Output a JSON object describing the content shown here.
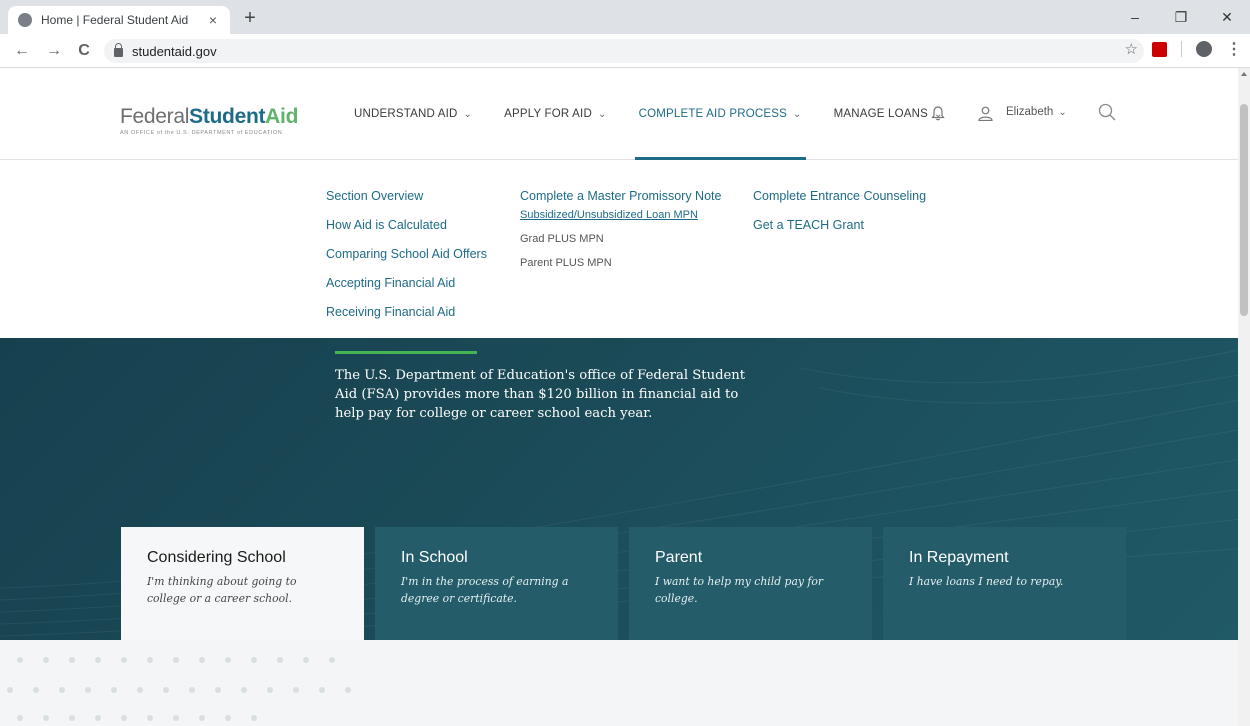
{
  "browser": {
    "tab_title": "Home | Federal Student Aid",
    "tab_close": "×",
    "new_tab": "+",
    "url": "studentaid.gov",
    "back": "←",
    "forward": "→",
    "reload": "C",
    "bookmark": "☆",
    "menu": "⋮",
    "minimize": "–",
    "maximize": "❐",
    "close": "✕"
  },
  "header": {
    "logo_text_federal": "Federal",
    "logo_text_student": "Student",
    "logo_text_aid": "Aid",
    "logo_subtitle": "AN OFFICE of the U.S. DEPARTMENT of EDUCATION",
    "nav": [
      {
        "label": "UNDERSTAND AID"
      },
      {
        "label": "APPLY FOR AID"
      },
      {
        "label": "COMPLETE AID PROCESS"
      },
      {
        "label": "MANAGE LOANS"
      }
    ],
    "user_name": "Elizabeth",
    "chevron": "⌄"
  },
  "mega_menu": {
    "col1": [
      "Section Overview",
      "How Aid is Calculated",
      "Comparing School Aid Offers",
      "Accepting Financial Aid",
      "Receiving Financial Aid"
    ],
    "col2_title": "Complete a Master Promissory Note",
    "col2_sub": [
      "Subsidized/Unsubsidized Loan MPN",
      "Grad PLUS MPN",
      "Parent PLUS MPN"
    ],
    "col3": [
      "Complete Entrance Counseling",
      "Get a TEACH Grant"
    ]
  },
  "hero": {
    "text": "The U.S. Department of Education's office of Federal Student Aid (FSA) provides more than $120 billion in financial aid to help pay for college or career school each year."
  },
  "cards": [
    {
      "title": "Considering School",
      "desc": "I'm thinking about going to college or a career school."
    },
    {
      "title": "In School",
      "desc": "I'm in the process of earning a degree or certificate."
    },
    {
      "title": "Parent",
      "desc": "I want to help my child pay for college."
    },
    {
      "title": "In Repayment",
      "desc": "I have loans I need to repay."
    }
  ],
  "colors": {
    "brand_blue": "#1e6b87",
    "brand_green": "#45b554",
    "hero_bg": "#1b4a57",
    "card_bg": "#245c69"
  }
}
